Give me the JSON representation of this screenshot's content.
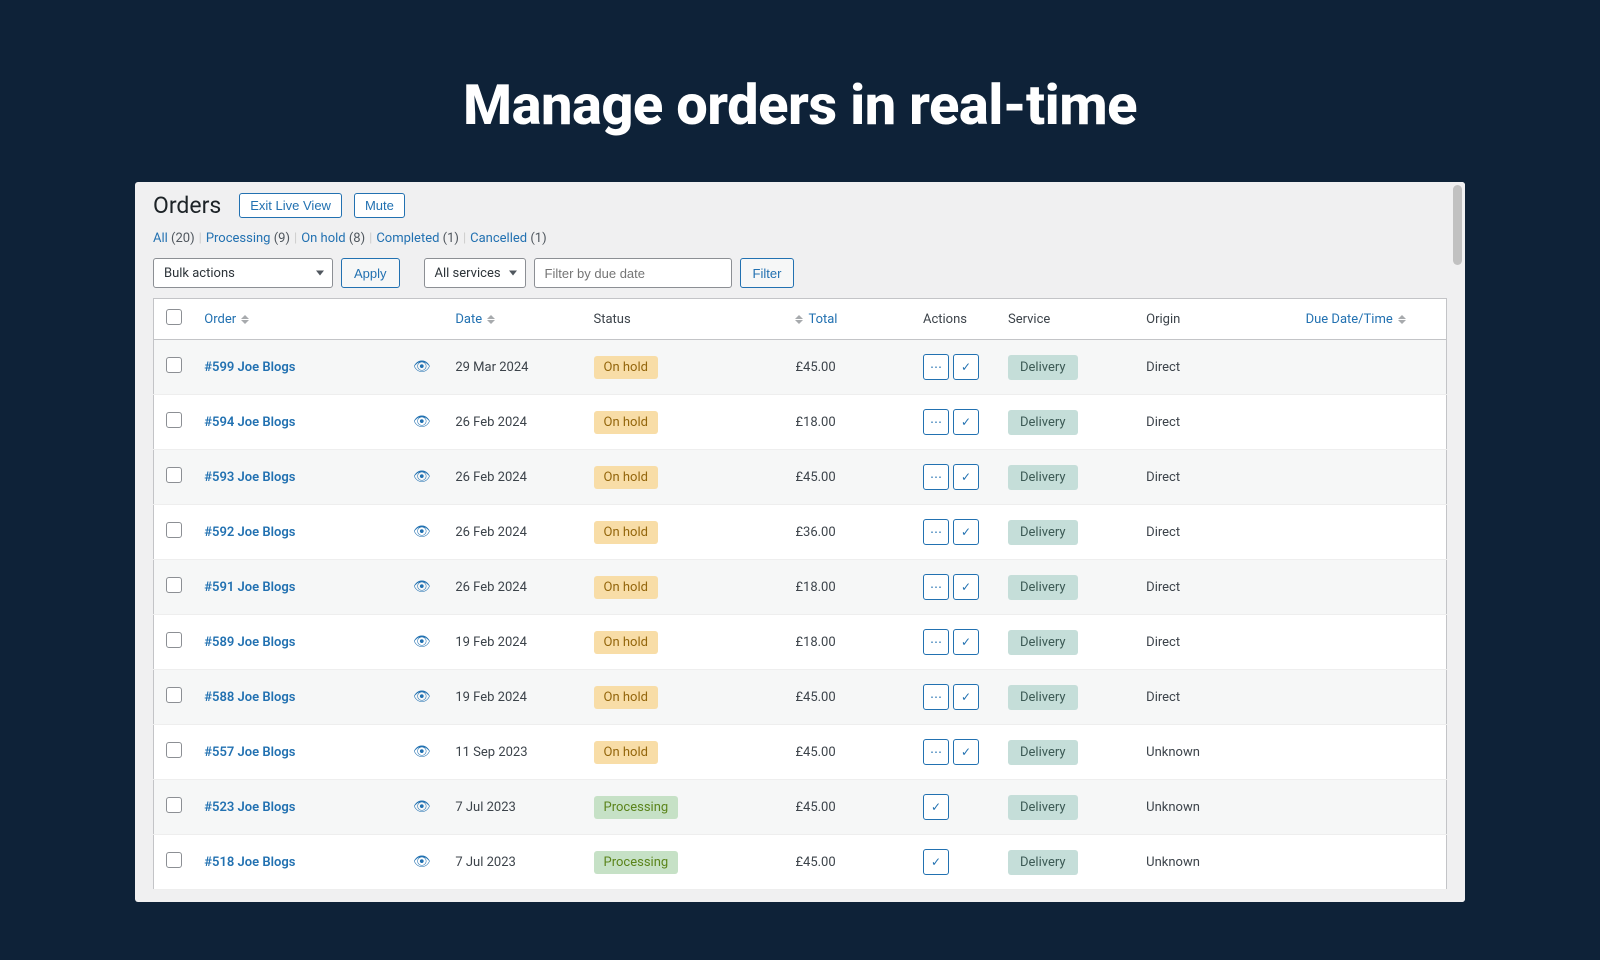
{
  "hero_title": "Manage orders in real-time",
  "page_title": "Orders",
  "header_buttons": {
    "exit_live_view": "Exit Live View",
    "mute": "Mute"
  },
  "filter_tabs": [
    {
      "label": "All",
      "count": "(20)"
    },
    {
      "label": "Processing",
      "count": "(9)"
    },
    {
      "label": "On hold",
      "count": "(8)"
    },
    {
      "label": "Completed",
      "count": "(1)"
    },
    {
      "label": "Cancelled",
      "count": "(1)"
    }
  ],
  "toolbar": {
    "bulk_actions_label": "Bulk actions",
    "apply_label": "Apply",
    "all_services_label": "All services",
    "due_date_placeholder": "Filter by due date",
    "filter_label": "Filter"
  },
  "columns": {
    "order": "Order",
    "date": "Date",
    "status": "Status",
    "total": "Total",
    "actions": "Actions",
    "service": "Service",
    "origin": "Origin",
    "due": "Due Date/Time"
  },
  "rows": [
    {
      "order": "#599 Joe Blogs",
      "date": "29 Mar 2024",
      "status": "On hold",
      "status_class": "status-on-hold",
      "total": "£45.00",
      "service": "Delivery",
      "origin": "Direct",
      "show_dots": true
    },
    {
      "order": "#594 Joe Blogs",
      "date": "26 Feb 2024",
      "status": "On hold",
      "status_class": "status-on-hold",
      "total": "£18.00",
      "service": "Delivery",
      "origin": "Direct",
      "show_dots": true
    },
    {
      "order": "#593 Joe Blogs",
      "date": "26 Feb 2024",
      "status": "On hold",
      "status_class": "status-on-hold",
      "total": "£45.00",
      "service": "Delivery",
      "origin": "Direct",
      "show_dots": true
    },
    {
      "order": "#592 Joe Blogs",
      "date": "26 Feb 2024",
      "status": "On hold",
      "status_class": "status-on-hold",
      "total": "£36.00",
      "service": "Delivery",
      "origin": "Direct",
      "show_dots": true
    },
    {
      "order": "#591 Joe Blogs",
      "date": "26 Feb 2024",
      "status": "On hold",
      "status_class": "status-on-hold",
      "total": "£18.00",
      "service": "Delivery",
      "origin": "Direct",
      "show_dots": true
    },
    {
      "order": "#589 Joe Blogs",
      "date": "19 Feb 2024",
      "status": "On hold",
      "status_class": "status-on-hold",
      "total": "£18.00",
      "service": "Delivery",
      "origin": "Direct",
      "show_dots": true
    },
    {
      "order": "#588 Joe Blogs",
      "date": "19 Feb 2024",
      "status": "On hold",
      "status_class": "status-on-hold",
      "total": "£45.00",
      "service": "Delivery",
      "origin": "Direct",
      "show_dots": true
    },
    {
      "order": "#557 Joe Blogs",
      "date": "11 Sep 2023",
      "status": "On hold",
      "status_class": "status-on-hold",
      "total": "£45.00",
      "service": "Delivery",
      "origin": "Unknown",
      "show_dots": true
    },
    {
      "order": "#523 Joe Blogs",
      "date": "7 Jul 2023",
      "status": "Processing",
      "status_class": "status-processing",
      "total": "£45.00",
      "service": "Delivery",
      "origin": "Unknown",
      "show_dots": false
    },
    {
      "order": "#518 Joe Blogs",
      "date": "7 Jul 2023",
      "status": "Processing",
      "status_class": "status-processing",
      "total": "£45.00",
      "service": "Delivery",
      "origin": "Unknown",
      "show_dots": false
    }
  ]
}
